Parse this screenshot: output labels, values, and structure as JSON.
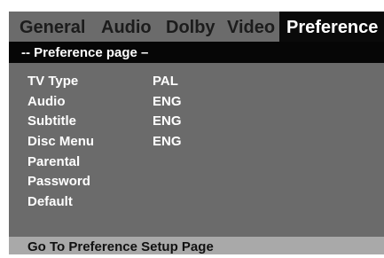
{
  "tabs": [
    {
      "label": "General"
    },
    {
      "label": "Audio"
    },
    {
      "label": "Dolby"
    },
    {
      "label": "Video"
    },
    {
      "label": "Preference",
      "active": true
    }
  ],
  "page_title": "-- Preference page –",
  "settings": [
    {
      "label": "TV Type",
      "value": "PAL"
    },
    {
      "label": "Audio",
      "value": "ENG"
    },
    {
      "label": "Subtitle",
      "value": "ENG"
    },
    {
      "label": "Disc Menu",
      "value": "ENG"
    },
    {
      "label": "Parental",
      "value": ""
    },
    {
      "label": "Password",
      "value": ""
    },
    {
      "label": "Default",
      "value": ""
    }
  ],
  "status": "Go To Preference Setup Page",
  "colors": {
    "screen_bg": "#6b6b6b",
    "active_tab_bg": "#0a0a0a",
    "page_bar_bg": "#060606",
    "status_bar_bg": "#a9a9a9",
    "text_light": "#ffffff",
    "text_dark": "#1c1c1c"
  }
}
